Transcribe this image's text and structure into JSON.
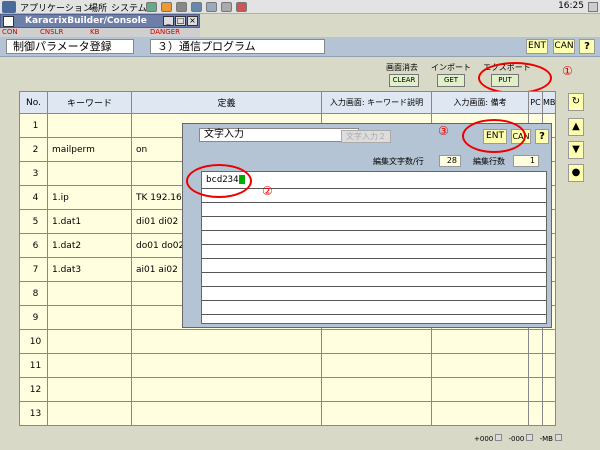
{
  "gnome_panel": {
    "menu_apps": "アプリケーション",
    "menu_places": "場所",
    "menu_system": "システム",
    "clock": "16:25"
  },
  "window": {
    "title": "KaracrixBuilder/Console",
    "min": "_",
    "max": "□",
    "close": "×",
    "toolbar_texts": [
      "CON",
      "CNSLR",
      "KB",
      "DANGER"
    ]
  },
  "header": {
    "param_title": "制御パラメータ登録",
    "program_title": "３）通信プログラム",
    "ent": "ENT",
    "can": "CAN",
    "help": "?"
  },
  "ops": {
    "clear_label": "画面消去",
    "import_label": "インポート",
    "export_label": "エクスポート",
    "clear_btn": "CLEAR",
    "get_btn": "GET",
    "put_btn": "PUT"
  },
  "markers": [
    "①",
    "②",
    "③"
  ],
  "table": {
    "headers": [
      "No.",
      "キーワード",
      "定義",
      "入力画面: キーワード説明",
      "入力画面: 備考",
      "PC",
      "MB"
    ],
    "rows": [
      {
        "no": "1",
        "keyword": "",
        "definition": ""
      },
      {
        "no": "2",
        "keyword": "mailperm",
        "definition": "on"
      },
      {
        "no": "3",
        "keyword": "",
        "definition": ""
      },
      {
        "no": "4",
        "keyword": "1.ip",
        "definition": "TK 192.168"
      },
      {
        "no": "5",
        "keyword": "1.dat1",
        "definition": "di01 di02"
      },
      {
        "no": "6",
        "keyword": "1.dat2",
        "definition": "do01 do02"
      },
      {
        "no": "7",
        "keyword": "1.dat3",
        "definition": "ai01 ai02"
      },
      {
        "no": "8",
        "keyword": "",
        "definition": ""
      },
      {
        "no": "9",
        "keyword": "",
        "definition": ""
      },
      {
        "no": "10",
        "keyword": "",
        "definition": ""
      },
      {
        "no": "11",
        "keyword": "",
        "definition": ""
      },
      {
        "no": "12",
        "keyword": "",
        "definition": ""
      },
      {
        "no": "13",
        "keyword": "",
        "definition": ""
      }
    ]
  },
  "side": {
    "refresh": "↻",
    "up": "▲",
    "down": "▼",
    "dot": "●"
  },
  "dialog": {
    "title": "文字入力",
    "tab": "文字入力２",
    "ent": "ENT",
    "can": "CAN",
    "help": "?",
    "chars_label": "編集文字数/行",
    "chars_value": "28",
    "lines_label": "編集行数",
    "lines_value": "1",
    "text": "bcd234"
  },
  "footer": {
    "p1": "+000",
    "p2": "-000",
    "p3": "-MB"
  }
}
